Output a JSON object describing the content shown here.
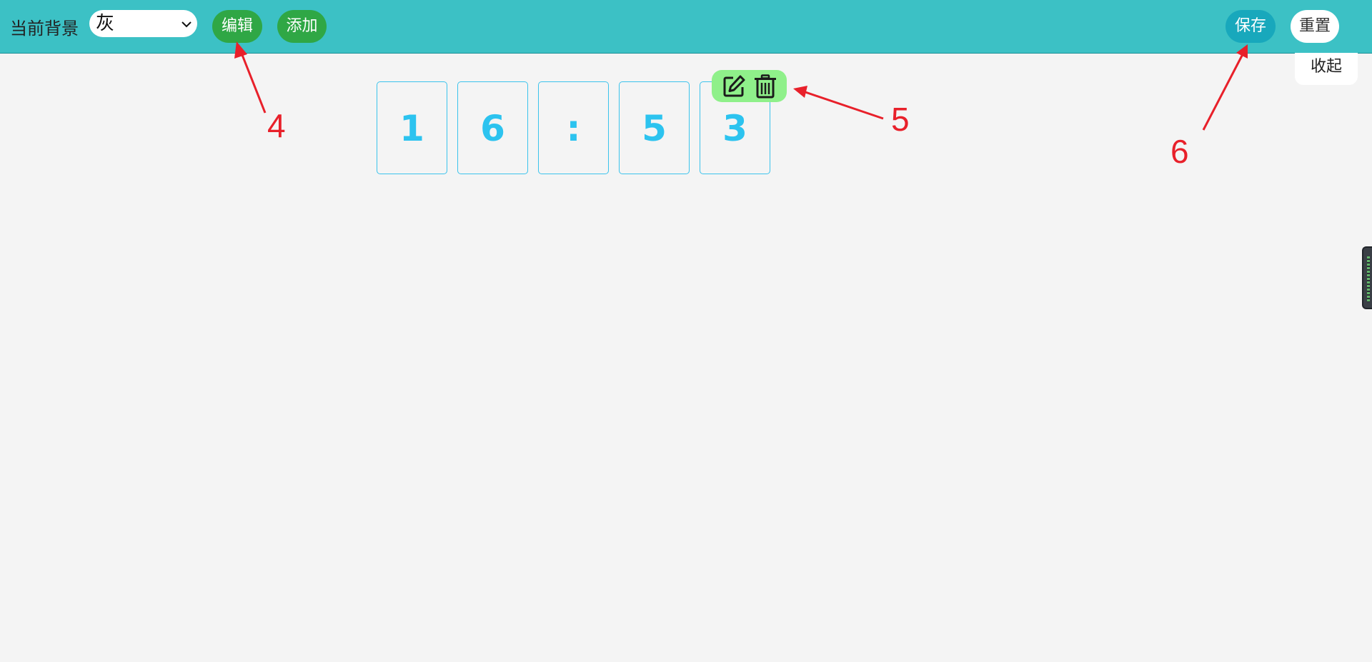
{
  "toolbar": {
    "background_label": "当前背景",
    "background_value": "灰",
    "edit_label": "编辑",
    "add_label": "添加",
    "save_label": "保存",
    "reset_label": "重置",
    "collapse_label": "收起"
  },
  "clock": {
    "digits": [
      "1",
      "6",
      ":",
      "5",
      "3"
    ],
    "digit_color": "#2cc3ef"
  },
  "annotations": {
    "edit_marker": "4",
    "toolbox_marker": "5",
    "save_marker": "6",
    "color": "#e8202a"
  },
  "colors": {
    "toolbar_bg": "#3cc1c5",
    "page_bg": "#f4f4f4",
    "green_button": "#2fa745",
    "save_button": "#18a8bc",
    "toolbox_bg": "#8ff08a"
  },
  "icons": {
    "dropdown": "chevron-down-icon",
    "toolbox_edit": "edit-icon",
    "toolbox_delete": "trash-icon"
  }
}
